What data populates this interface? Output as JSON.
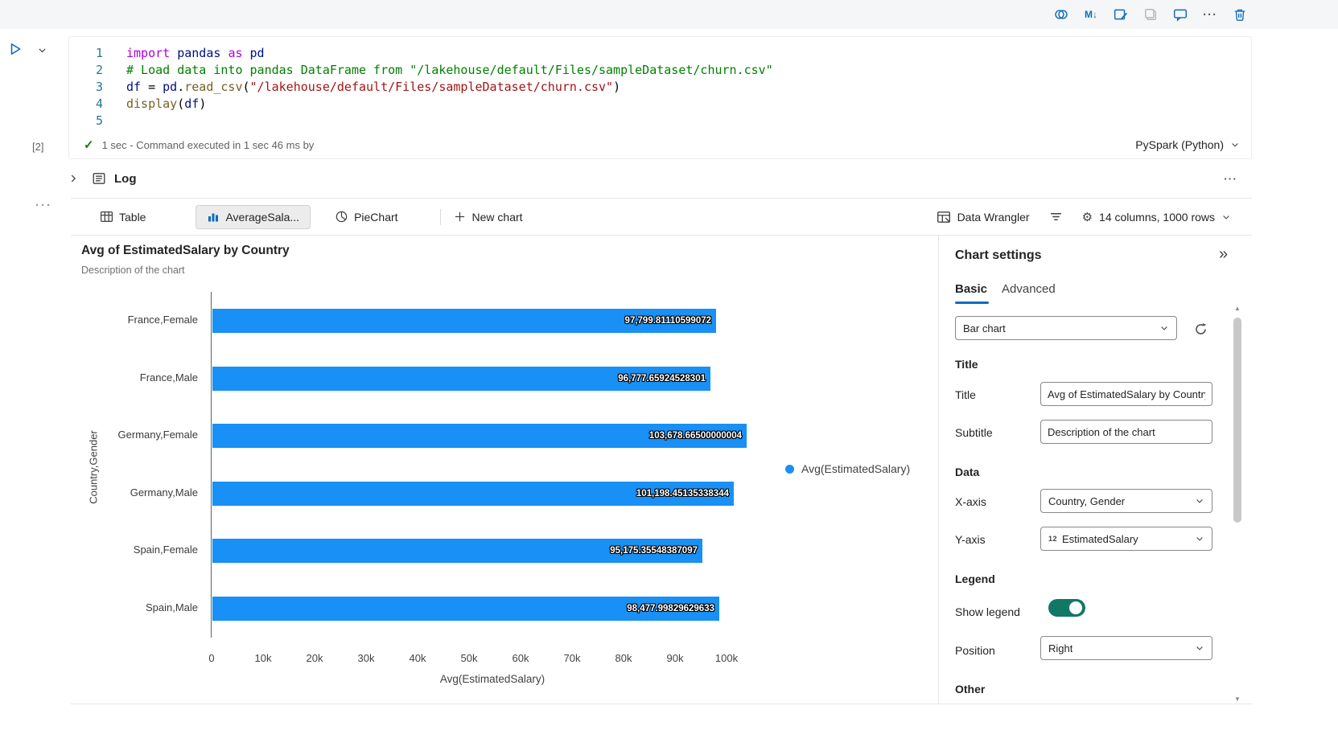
{
  "ui_colors": {
    "accent": "#0f6cbd",
    "bar_blue": "#1890f5",
    "toggle_teal": "#117865"
  },
  "top_toolbar": {
    "icons": [
      "copilot-icon",
      "markdown-icon",
      "edit-cell-icon",
      "copy-icon",
      "comment-icon",
      "more-icon",
      "delete-icon"
    ]
  },
  "code_cell": {
    "execution_label": "[2]",
    "status_text": "1 sec - Command executed in 1 sec 46 ms by",
    "kernel_label": "PySpark (Python)",
    "code_colors": {
      "kw": "#af00db",
      "id": "#001080",
      "cm": "#008000",
      "st": "#a31515",
      "fn": "#795e26",
      "pl": "#000000"
    },
    "lines": [
      {
        "n": "1",
        "tokens": [
          [
            "import",
            "kw"
          ],
          [
            " ",
            "pl"
          ],
          [
            "pandas",
            "id"
          ],
          [
            " ",
            "pl"
          ],
          [
            "as",
            "kw"
          ],
          [
            " ",
            "pl"
          ],
          [
            "pd",
            "id"
          ]
        ]
      },
      {
        "n": "2",
        "tokens": [
          [
            "# Load data into pandas DataFrame from \"/lakehouse/default/Files/sampleDataset/churn.csv\"",
            "cm"
          ]
        ]
      },
      {
        "n": "3",
        "tokens": [
          [
            "df",
            "id"
          ],
          [
            " ",
            "pl"
          ],
          [
            "=",
            "pl"
          ],
          [
            " ",
            "pl"
          ],
          [
            "pd",
            "id"
          ],
          [
            ".",
            "pl"
          ],
          [
            "read_csv",
            "fn"
          ],
          [
            "(",
            "pl"
          ],
          [
            "\"/lakehouse/default/Files/sampleDataset/churn.csv\"",
            "st"
          ],
          [
            ")",
            "pl"
          ]
        ]
      },
      {
        "n": "4",
        "tokens": [
          [
            "display",
            "fn"
          ],
          [
            "(",
            "pl"
          ],
          [
            "df",
            "id"
          ],
          [
            ")",
            "pl"
          ]
        ]
      },
      {
        "n": "5",
        "tokens": []
      }
    ]
  },
  "log_section": {
    "label": "Log"
  },
  "result_toolbar": {
    "tabs": [
      {
        "label": "Table",
        "icon": "table-icon",
        "selected": false
      },
      {
        "label": "AverageSala...",
        "icon": "column-chart-icon",
        "selected": true
      },
      {
        "label": "PieChart",
        "icon": "pie-chart-icon",
        "selected": false
      }
    ],
    "new_chart_label": "New chart",
    "data_wrangler_label": "Data Wrangler",
    "summary_label": "14 columns, 1000 rows"
  },
  "chart_data": {
    "type": "bar",
    "orientation": "horizontal",
    "title": "Avg of EstimatedSalary by Country",
    "subtitle": "Description of the chart",
    "categories": [
      "France,Female",
      "France,Male",
      "Germany,Female",
      "Germany,Male",
      "Spain,Female",
      "Spain,Male"
    ],
    "values": [
      97799.81110599072,
      96777.65924528301,
      103678.66500000004,
      101198.45135338344,
      95175.35548387097,
      98477.99829629633
    ],
    "value_labels": [
      "97,799.81110599072",
      "96,777.65924528301",
      "103,678.66500000004",
      "101,198.45135338344",
      "95,175.35548387097",
      "98,477.99829629633"
    ],
    "xlabel": "Avg(EstimatedSalary)",
    "ylabel": "Country,Gender",
    "x_ticks": [
      "0",
      "10k",
      "20k",
      "30k",
      "40k",
      "50k",
      "60k",
      "70k",
      "80k",
      "90k",
      "100k"
    ],
    "xlim": [
      0,
      100000
    ],
    "grid": false,
    "legend": {
      "position": "right",
      "entries": [
        "Avg(EstimatedSalary)"
      ]
    },
    "bar_color": "#1890f5"
  },
  "settings": {
    "header": "Chart settings",
    "tabs": [
      "Basic",
      "Advanced"
    ],
    "active_tab": "Basic",
    "chart_type": "Bar chart",
    "sections": {
      "title": {
        "header": "Title",
        "title_label": "Title",
        "title_value": "Avg of EstimatedSalary by Country",
        "subtitle_label": "Subtitle",
        "subtitle_value": "Description of the chart"
      },
      "data": {
        "header": "Data",
        "xaxis_label": "X-axis",
        "xaxis_value": "Country, Gender",
        "yaxis_label": "Y-axis",
        "yaxis_icon": "12",
        "yaxis_value": "EstimatedSalary"
      },
      "legend": {
        "header": "Legend",
        "show_label": "Show legend",
        "show_value": true,
        "position_label": "Position",
        "position_value": "Right"
      },
      "other": {
        "header": "Other"
      }
    }
  }
}
